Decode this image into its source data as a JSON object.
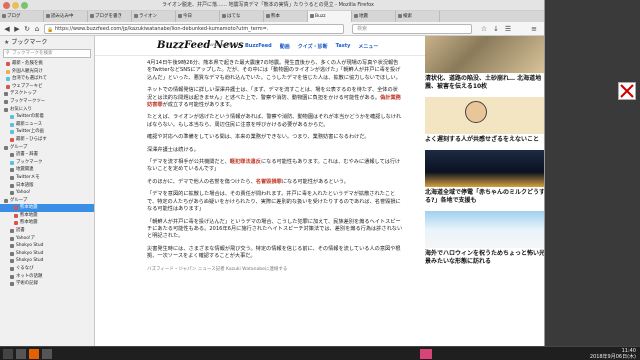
{
  "window": {
    "title": "ライオン脱走、井戸に落…… 地震写真デマ「熊本の実情」たりうるとの見立 - Mozilla Firefox"
  },
  "tabs": [
    {
      "label": "ブログ"
    },
    {
      "label": "読み込み中"
    },
    {
      "label": "ブログを書き"
    },
    {
      "label": "ライオン"
    },
    {
      "label": "今日"
    },
    {
      "label": "はてな"
    },
    {
      "label": "熊本"
    },
    {
      "label": "Buzz"
    },
    {
      "label": "地震"
    },
    {
      "label": "検索"
    }
  ],
  "navbar": {
    "url": "https://www.buzzfeed.com/jp/kazukiwatanabe/lion-debunked-kumamoto?utm_term=.",
    "search_placeholder": "検索"
  },
  "sidebar": {
    "header": "ブックマーク",
    "search_placeholder": "ブックマークを検索",
    "items": [
      {
        "label": "最新・危険を挑",
        "color": "#d9534f"
      },
      {
        "label": "外国人観光向け",
        "color": "#f0ad4e"
      },
      {
        "label": "台湾でも選ばれて",
        "color": "#5bc0de"
      },
      {
        "label": "ウェブアーキビ",
        "color": "#d9534f"
      },
      {
        "label": "デスクトップ",
        "color": "#777"
      },
      {
        "label": "ブックマークツー",
        "color": "#777"
      },
      {
        "label": "お気に入り",
        "color": "#777"
      },
      {
        "label": "Twitterの新着",
        "color": "#5bc0de"
      },
      {
        "label": "最新ニュース",
        "color": "#5bc0de"
      },
      {
        "label": "Twitter上の画",
        "color": "#5bc0de"
      },
      {
        "label": "最新・ひらばす",
        "color": "#d9534f"
      },
      {
        "label": "グループ",
        "color": "#777"
      },
      {
        "label": "読書・辞書",
        "color": "#777"
      },
      {
        "label": "ブックマーク",
        "color": "#5bc0de"
      },
      {
        "label": "地震関連",
        "color": "#777"
      },
      {
        "label": "Twitterメモ",
        "color": "#777"
      },
      {
        "label": "日本語版",
        "color": "#777"
      },
      {
        "label": "Yahoo!",
        "color": "#777"
      },
      {
        "label": "グループ",
        "color": "#777"
      },
      {
        "label": "熊本地震",
        "color": "#d9534f"
      },
      {
        "label": "熊本地震",
        "color": "#d9534f"
      },
      {
        "label": "熊本地震",
        "color": "#d9534f"
      },
      {
        "label": "読書",
        "color": "#777"
      },
      {
        "label": "Yahoo!ア",
        "color": "#777"
      },
      {
        "label": "Shokyo Stud",
        "color": "#777"
      },
      {
        "label": "Shokyo Stud",
        "color": "#777"
      },
      {
        "label": "Shokyo Stud",
        "color": "#777"
      },
      {
        "label": "ぐるなび",
        "color": "#777"
      },
      {
        "label": "ネットの話題",
        "color": "#777"
      },
      {
        "label": "学術の記録",
        "color": "#777"
      }
    ]
  },
  "site": {
    "logo": "BuzzFeed News",
    "logo_sub": "JAPAN BuzzFeed",
    "nav": [
      "BuzzFeed",
      "動画",
      "クイズ・診断",
      "Tasty",
      "メニュー"
    ]
  },
  "article": {
    "paragraphs": [
      "4月14日午後9時26分、熊本県で起きた最大震度7の地震。発生直後から、多くの人が現場の写真や状況報告をTwitterなどSNSにアップした。だが、その中には「動物園のライオンが逃げた」「朝鮮人が井戸に毒を投げ込んだ」といった、悪質なデマも紛れ込んでいた。こうしたデマを信じた人は、拡散に協力しないでほしい。",
      "ネットでの情報発信に詳しい深澤弁護士は、「まず、デマを流すことは、場を公表するのを待たず、全体の状況とは法的な問題は起きません」と述べた上で、警察や消防、動物園に負担をかける可能性がある。偽計業務妨害罪が成立する可能性があります。",
      "たとえば、ライオンが逃げたという情報があれば、警察や消防、動物園はそれが本当かどうかを確認しなければならない。もし本当なら、周辺住民に注意を呼びかける必要があるからだ。",
      "確認や対応への準備をしている間は、本来の業務ができない。つまり、業務妨害になるわけだ。",
      "深澤弁護士は続ける。",
      "「デマを流す相手が公共機関だと、軽犯罪法違反になる可能性もあります。これは、むやみに通報しては行けないことを定めているんです」",
      "そのほかに、デマで他人の名誉を傷つけたら、名誉毀損罪になる可能性があるという。",
      "「デマを意図的に拡散した場合は、その責任が問われます。井戸に毒を入れたというデマが拡散されたことで、特定の人たちがあらぬ疑いをかけられたり、実際に差別的な扱いを受けたりするのであれば、名誉毀損になる可能性はあります」",
      "「朝鮮人が井戸に毒を投げ込んだ」というデマの場合、こうした犯罪に加えて、民族差別を煽るヘイトスピーチにあたる可能性もある。2016年6月に施行されたヘイトスピーチ対策法では、差別を煽る行為は許されないと明記された。",
      "災害発生時には、さまざまな情報が飛び交う。特定の情報を信じる前に、その情報を流している人の意図や根拠、一次ソースをよく確認することが大事だ。"
    ],
    "highlight": "偽計業務妨害罪",
    "highlight2": "軽犯罪法違反",
    "highlight3": "名誉毀損罪",
    "byline": "バズフィード・ジャパン ニュース記者\nKazuki Watanabeに連絡する"
  },
  "aside": {
    "cards": [
      {
        "title": "清状化、道路の陥没、土砂崩れ… 北海道地震、被害を伝える10枚"
      },
      {
        "title": "よく遅刻する人が共感せざるをえないこと"
      },
      {
        "title": "北海道全域で停電「赤ちゃんのミルクどうする?」各地で支援も"
      },
      {
        "title": "海外でハロウィンを祝うためちょっと怖い光景みたいな形態に訪れる"
      }
    ]
  },
  "taskbar": {
    "time": "11:40",
    "date": "2018年9月06日(木)"
  },
  "colors": {
    "accent": "#3a8ee6",
    "highlight": "#c0392b"
  }
}
